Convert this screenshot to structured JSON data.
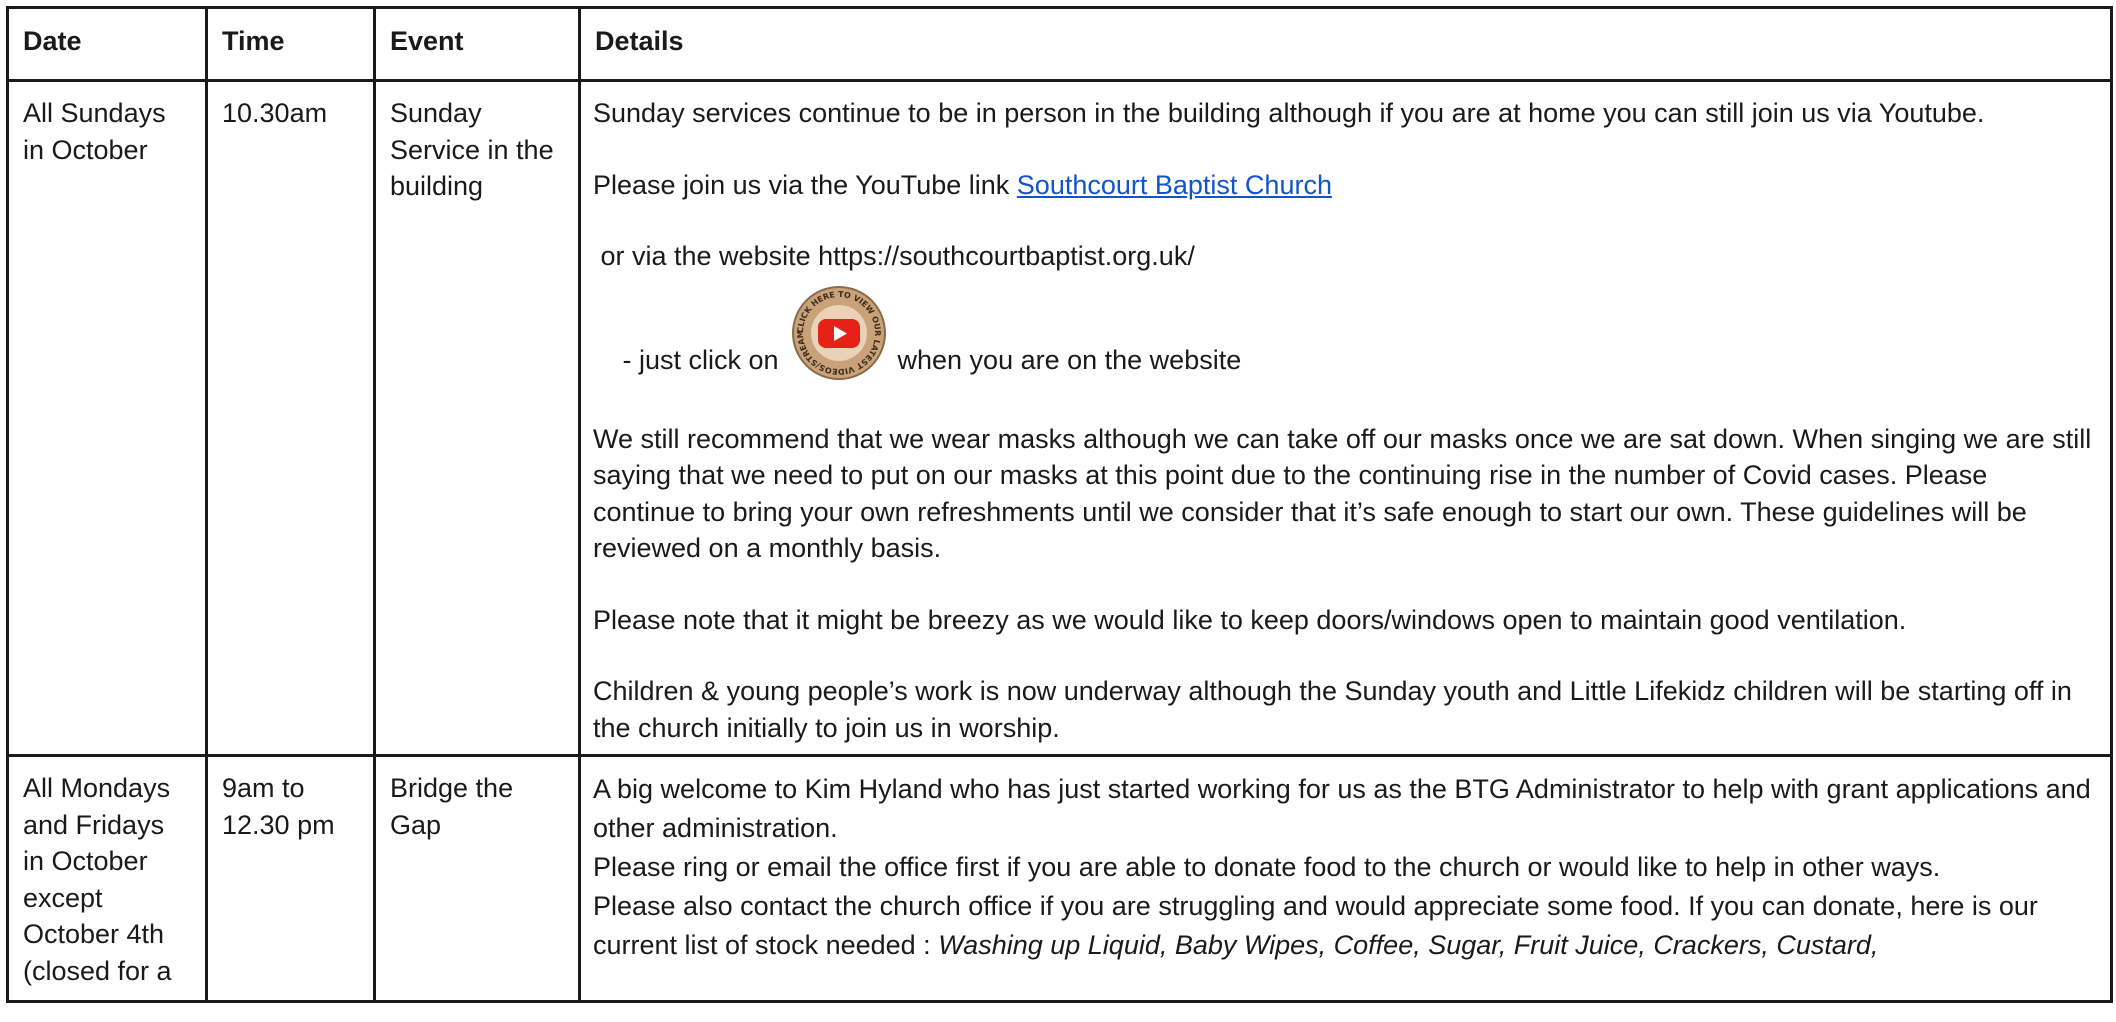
{
  "table": {
    "headers": {
      "date": "Date",
      "time": "Time",
      "event": "Event",
      "details": "Details"
    },
    "rows": [
      {
        "date": "All Sundays in October",
        "time": "10.30am",
        "event": "Sunday Service in the building",
        "details": {
          "p1": "Sunday services continue to be in person in the building although if you are at home you can still join us via Youtube.",
          "p2_prefix": "Please join us via the YouTube link ",
          "p2_link": "Southcourt Baptist Church",
          "p3": " or via the website https://southcourtbaptist.org.uk/",
          "p4_before": " - just click on ",
          "p4_button_icon": "youtube-play-badge-icon",
          "p4_button_ring_text": "CLICK HERE TO VIEW OUR LATEST VIDEOS/STREAMS",
          "p4_after": " when you are on the website",
          "p5": "We still recommend that we wear masks although we can take off our masks once we are sat down. When singing we are still saying that we need to put on our masks at this point due to the continuing rise in the number of Covid cases. Please continue to bring your own refreshments until we consider that it’s safe enough to start our own. These guidelines will be reviewed on a monthly basis.",
          "p6": "Please note that it might be breezy as we would like to keep doors/windows open to maintain good ventilation.",
          "p7": "Children & young people’s work is now underway although the Sunday youth and Little Lifekidz children will be starting off in the church initially to join us in worship."
        }
      },
      {
        "date": "All Mondays and Fridays in October except October 4th (closed for a",
        "time": "9am to 12.30 pm",
        "event": "Bridge the Gap",
        "details": {
          "l1": "A big welcome to Kim Hyland who has just started working for us as the BTG Administrator to help with grant applications and other administration.",
          "l2": "Please ring or email the office first if you are able to donate food to the church or would like to help in other ways.",
          "l3_prefix": "Please also contact the church office if you are struggling and would appreciate some food. If you can donate, here is our current list of stock needed : ",
          "l3_italic": "Washing up Liquid, Baby Wipes, Coffee, Sugar, Fruit Juice, Crackers, Custard,"
        }
      }
    ]
  },
  "colors": {
    "border": "#1a1a1a",
    "link": "#1155cc",
    "badge_ring": "#c9a27a",
    "badge_red": "#e62117"
  }
}
